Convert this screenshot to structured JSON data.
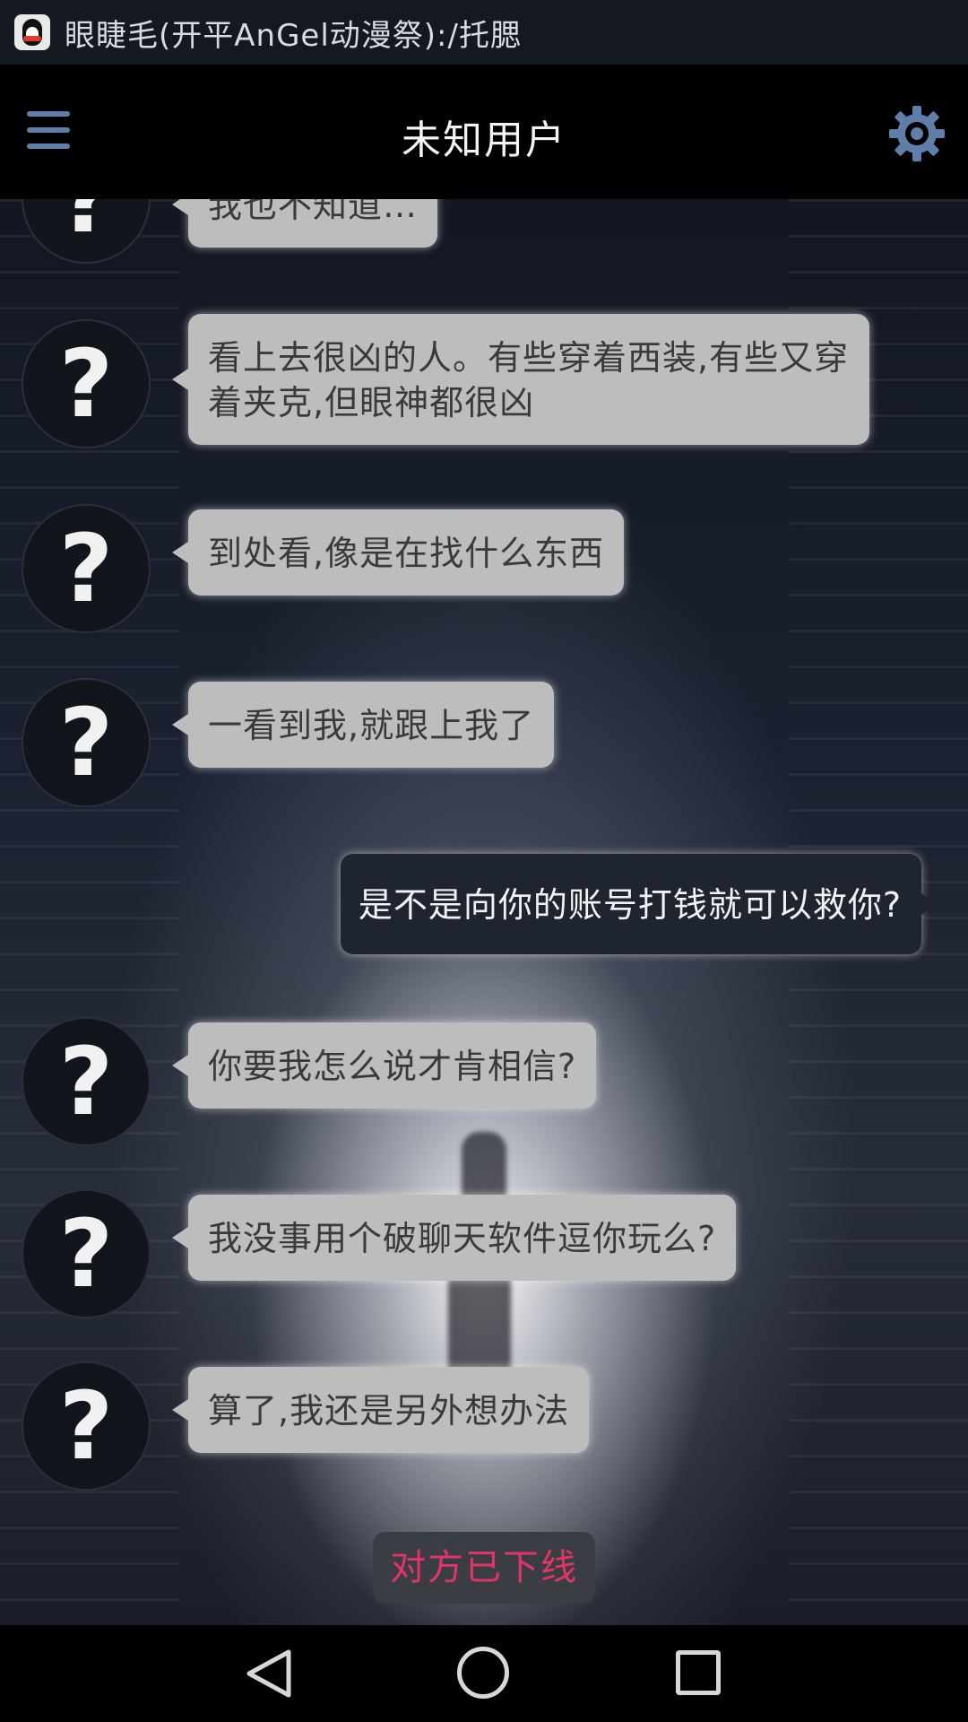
{
  "status_bar": {
    "notification_text": "眼睫毛(开平AnGel动漫祭):/托腮",
    "app_icon": "qq-penguin-icon"
  },
  "header": {
    "title": "未知用户",
    "menu_icon": "hamburger-menu-icon",
    "settings_icon": "gear-icon"
  },
  "chat": {
    "avatar_symbol": "?",
    "messages": [
      {
        "side": "incoming",
        "text": "我也不知道…"
      },
      {
        "side": "incoming",
        "text": "看上去很凶的人。有些穿着西装,有些又穿着夹克,但眼神都很凶"
      },
      {
        "side": "incoming",
        "text": "到处看,像是在找什么东西"
      },
      {
        "side": "incoming",
        "text": "一看到我,就跟上我了"
      },
      {
        "side": "outgoing",
        "text": "是不是向你的账号打钱就可以救你?"
      },
      {
        "side": "incoming",
        "text": "你要我怎么说才肯相信?"
      },
      {
        "side": "incoming",
        "text": "我没事用个破聊天软件逗你玩么?"
      },
      {
        "side": "incoming",
        "text": "算了,我还是另外想办法"
      }
    ],
    "status_badge": "对方已下线"
  },
  "colors": {
    "incoming_bubble": "#bdbdbd",
    "outgoing_bubble": "#1e2430",
    "offline_text": "#e03566",
    "accent_icon": "#5f7ea9"
  },
  "nav_bar": {
    "back_icon": "back-triangle-icon",
    "home_icon": "home-circle-icon",
    "recent_icon": "recent-apps-square-icon"
  }
}
